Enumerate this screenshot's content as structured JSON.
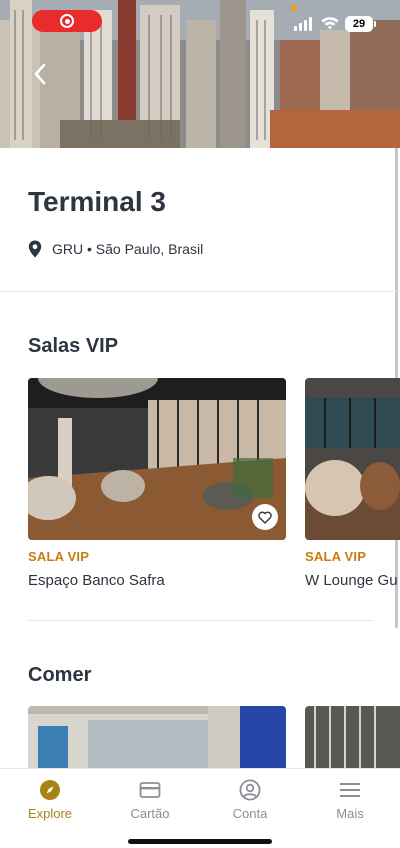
{
  "status_bar": {
    "battery": "29",
    "colors": {
      "record": "#ea2b2b",
      "dot": "#f29a19"
    }
  },
  "header": {
    "back_icon": "chevron-left-icon"
  },
  "terminal": {
    "title": "Terminal 3",
    "location": "GRU • São Paulo, Brasil",
    "location_icon": "map-pin-icon"
  },
  "lounges": {
    "section_title": "Salas VIP",
    "cards": [
      {
        "category": "SALA VIP",
        "name": "Espaço Banco Safra",
        "favorite_icon": "heart-icon"
      },
      {
        "category": "SALA VIP",
        "name": "W Lounge Gu"
      }
    ]
  },
  "food": {
    "section_title": "Comer"
  },
  "tabbar": {
    "tabs": [
      {
        "label": "Explore",
        "icon": "compass-icon",
        "active": true
      },
      {
        "label": "Cartão",
        "icon": "card-icon",
        "active": false
      },
      {
        "label": "Conta",
        "icon": "user-circle-icon",
        "active": false
      },
      {
        "label": "Mais",
        "icon": "menu-icon",
        "active": false
      }
    ],
    "colors": {
      "active": "#a88512",
      "inactive": "#8a8f95"
    }
  }
}
